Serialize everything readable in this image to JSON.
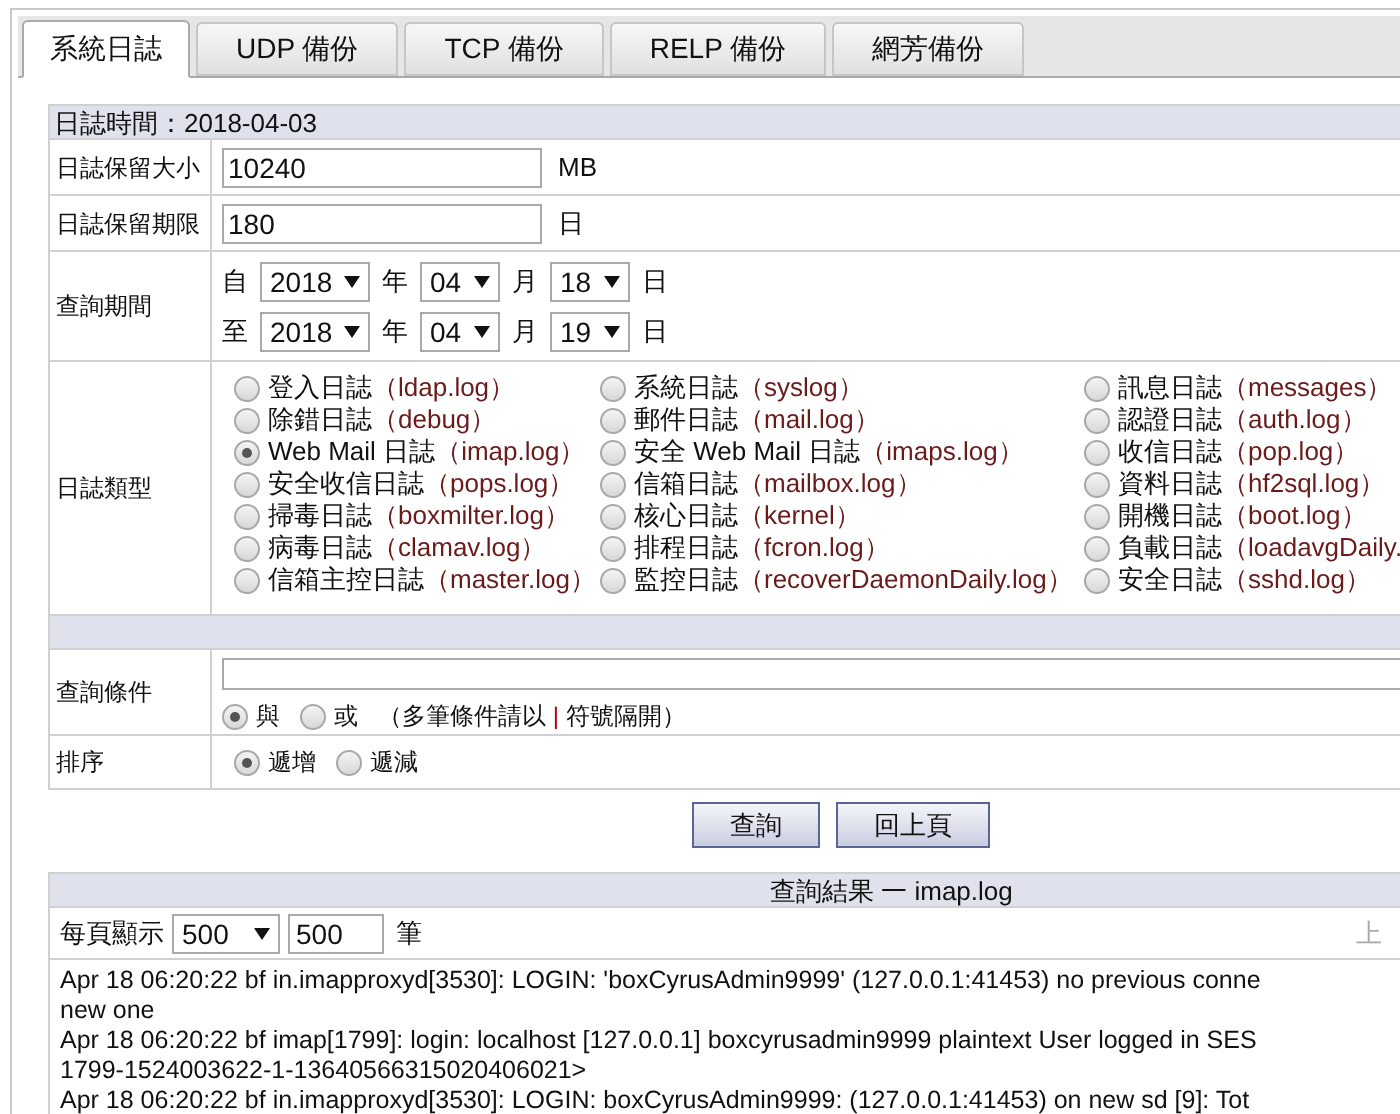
{
  "tabs": [
    {
      "label": "系統日誌",
      "selected": true
    },
    {
      "label": "UDP 備份",
      "selected": false
    },
    {
      "label": "TCP 備份",
      "selected": false
    },
    {
      "label": "RELP 備份",
      "selected": false
    },
    {
      "label": "網芳備份",
      "selected": false
    }
  ],
  "log_date": "日誌時間：2018-04-03",
  "size": {
    "label": "日誌保留大小",
    "value": "10240",
    "unit": "MB"
  },
  "keep": {
    "label": "日誌保留期限",
    "value": "180",
    "unit": "日"
  },
  "period": {
    "label": "查詢期間",
    "rows": [
      {
        "prefix": "自",
        "year": "2018",
        "year_unit": "年",
        "month": "04",
        "month_unit": "月",
        "day": "18",
        "day_unit": "日"
      },
      {
        "prefix": "至",
        "year": "2018",
        "year_unit": "年",
        "month": "04",
        "month_unit": "月",
        "day": "19",
        "day_unit": "日"
      }
    ]
  },
  "log_type": {
    "label": "日誌類型",
    "columns": [
      [
        {
          "label": "登入日誌",
          "file": "（ldap.log）",
          "selected": false
        },
        {
          "label": "除錯日誌",
          "file": "（debug）",
          "selected": false
        },
        {
          "label": "Web Mail 日誌",
          "file": "（imap.log）",
          "selected": true
        },
        {
          "label": "安全收信日誌",
          "file": "（pops.log）",
          "selected": false
        },
        {
          "label": "掃毒日誌",
          "file": "（boxmilter.log）",
          "selected": false
        },
        {
          "label": "病毒日誌",
          "file": "（clamav.log）",
          "selected": false
        },
        {
          "label": "信箱主控日誌",
          "file": "（master.log）",
          "selected": false
        }
      ],
      [
        {
          "label": "系統日誌",
          "file": "（syslog）",
          "selected": false
        },
        {
          "label": "郵件日誌",
          "file": "（mail.log）",
          "selected": false
        },
        {
          "label": "安全 Web Mail 日誌",
          "file": "（imaps.log）",
          "selected": false
        },
        {
          "label": "信箱日誌",
          "file": "（mailbox.log）",
          "selected": false
        },
        {
          "label": "核心日誌",
          "file": "（kernel）",
          "selected": false
        },
        {
          "label": "排程日誌",
          "file": "（fcron.log）",
          "selected": false
        },
        {
          "label": "監控日誌",
          "file": "（recoverDaemonDaily.log）",
          "selected": false
        }
      ],
      [
        {
          "label": "訊息日誌",
          "file": "（messages）",
          "selected": false
        },
        {
          "label": "認證日誌",
          "file": "（auth.log）",
          "selected": false
        },
        {
          "label": "收信日誌",
          "file": "（pop.log）",
          "selected": false
        },
        {
          "label": "資料日誌",
          "file": "（hf2sql.log）",
          "selected": false
        },
        {
          "label": "開機日誌",
          "file": "（boot.log）",
          "selected": false
        },
        {
          "label": "負載日誌",
          "file": "（loadavgDaily.",
          "selected": false
        },
        {
          "label": "安全日誌",
          "file": "（sshd.log）",
          "selected": false
        }
      ]
    ]
  },
  "condition": {
    "label": "查詢條件",
    "options": [
      {
        "label": "與",
        "selected": true
      },
      {
        "label": "或",
        "selected": false
      }
    ],
    "hint": "（多筆條件請以",
    "pipe": "|",
    "hint_end": "符號隔開）"
  },
  "sort": {
    "label": "排序",
    "options": [
      {
        "label": "遞增",
        "selected": true
      },
      {
        "label": "遞減",
        "selected": false
      }
    ]
  },
  "buttons": [
    "查詢",
    "回上頁"
  ],
  "result": {
    "title": "查詢結果 一 imap.log",
    "per_page_label": "每頁顯示",
    "per_page_select": "500",
    "per_page_value": "500",
    "per_page_unit": "筆",
    "prev": "上",
    "lines": [
      "Apr 18 06:20:22 bf in.imapproxyd[3530]: LOGIN: 'boxCyrusAdmin9999' (127.0.0.1:41453) no previous conne",
      "new one",
      "Apr 18 06:20:22 bf imap[1799]: login: localhost [127.0.0.1] boxcyrusadmin9999 plaintext User logged in SES",
      "1799-1524003622-1-13640566315020406021>",
      "Apr 18 06:20:22 bf in.imapproxyd[3530]: LOGIN: boxCyrusAdmin9999: (127.0.0.1:41453) on new sd [9]: Tot"
    ]
  }
}
